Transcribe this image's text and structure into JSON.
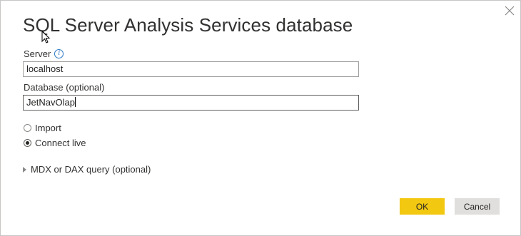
{
  "dialog": {
    "title": "SQL Server Analysis Services database",
    "close_icon": "close-icon"
  },
  "server": {
    "label": "Server",
    "info_icon": "info-icon",
    "value": "localhost"
  },
  "database": {
    "label": "Database (optional)",
    "value": "JetNavOlap"
  },
  "connectivity": {
    "options": [
      {
        "label": "Import",
        "selected": false
      },
      {
        "label": "Connect live",
        "selected": true
      }
    ]
  },
  "advanced": {
    "label": "MDX or DAX query (optional)",
    "expanded": false
  },
  "buttons": {
    "ok_label": "OK",
    "cancel_label": "Cancel"
  },
  "colors": {
    "primary_button": "#f2c811",
    "secondary_button": "#e1dfdd",
    "info_accent": "#2b78c5"
  }
}
